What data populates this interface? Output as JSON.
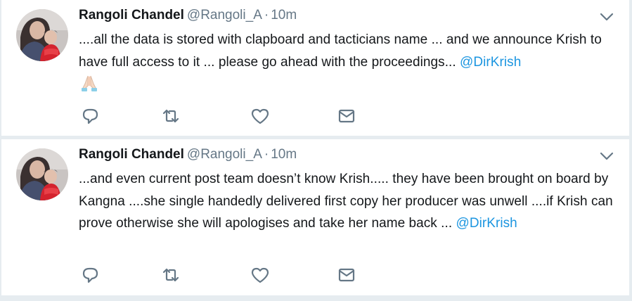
{
  "tweets": [
    {
      "author_name": "Rangoli Chandel",
      "handle": "@Rangoli_A",
      "separator": "·",
      "time": "10m",
      "text": "....all the data is stored with clapboard and tacticians name ... and we announce Krish to have full access to it ... please go ahead with the proceedings... ",
      "mention": "@DirKrish",
      "emoji": "folded-hands-emoji"
    },
    {
      "author_name": "Rangoli Chandel",
      "handle": "@Rangoli_A",
      "separator": "·",
      "time": "10m",
      "text": "...and even current post team doesn’t know Krish..... they have been brought on board by Kangna ....she single handedly delivered first copy her producer was unwell ....if Krish can prove otherwise she will apologises and take her name back ... ",
      "mention": "@DirKrish"
    }
  ],
  "icons": {
    "reply": "reply-icon",
    "retweet": "retweet-icon",
    "like": "heart-icon",
    "dm": "envelope-icon",
    "caret": "chevron-down-icon"
  },
  "colors": {
    "text": "#14171a",
    "secondary": "#657786",
    "link": "#1b95e0",
    "background": "#e6ecf0",
    "card": "#ffffff"
  }
}
